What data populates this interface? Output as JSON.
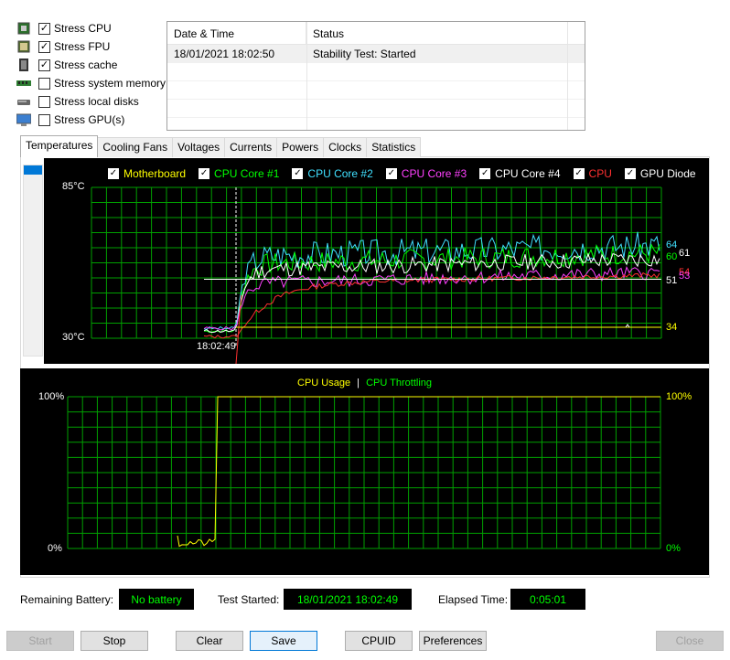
{
  "stress_options": [
    {
      "label": "Stress CPU",
      "checked": true,
      "icon": "cpu-icon"
    },
    {
      "label": "Stress FPU",
      "checked": true,
      "icon": "fpu-icon"
    },
    {
      "label": "Stress cache",
      "checked": true,
      "icon": "cache-icon"
    },
    {
      "label": "Stress system memory",
      "checked": false,
      "icon": "memory-icon"
    },
    {
      "label": "Stress local disks",
      "checked": false,
      "icon": "disk-icon"
    },
    {
      "label": "Stress GPU(s)",
      "checked": false,
      "icon": "gpu-icon"
    }
  ],
  "log": {
    "col_datetime": "Date & Time",
    "col_status": "Status",
    "rows": [
      {
        "datetime": "18/01/2021 18:02:50",
        "status": "Stability Test: Started"
      }
    ]
  },
  "tabs": [
    "Temperatures",
    "Cooling Fans",
    "Voltages",
    "Currents",
    "Powers",
    "Clocks",
    "Statistics"
  ],
  "active_tab": "Temperatures",
  "temp_graph": {
    "y_max_label": "85°C",
    "y_min_label": "30°C",
    "time_label": "18:02:49",
    "legend": [
      {
        "name": "Motherboard",
        "color": "#ffff00"
      },
      {
        "name": "CPU Core #1",
        "color": "#00ff00"
      },
      {
        "name": "CPU Core #2",
        "color": "#40e0ff"
      },
      {
        "name": "CPU Core #3",
        "color": "#ff40ff"
      },
      {
        "name": "CPU Core #4",
        "color": "#ffffff"
      },
      {
        "name": "CPU",
        "color": "#ff3030"
      },
      {
        "name": "GPU Diode",
        "color": "#ffffff"
      }
    ],
    "end_values": [
      {
        "value": "64",
        "color": "#40e0ff"
      },
      {
        "value": "61",
        "color": "#ffffff"
      },
      {
        "value": "60",
        "color": "#00ff00"
      },
      {
        "value": "54",
        "color": "#ff3030"
      },
      {
        "value": "53",
        "color": "#ff40ff"
      },
      {
        "value": "51",
        "color": "#ffffff"
      },
      {
        "value": "34",
        "color": "#ffff00"
      }
    ]
  },
  "usage_graph": {
    "title_cpu_usage": "CPU Usage",
    "separator": "|",
    "title_throttling": "CPU Throttling",
    "left_top": "100%",
    "left_bottom": "0%",
    "right_top": "100%",
    "right_bottom": "0%"
  },
  "info": {
    "battery_label": "Remaining Battery:",
    "battery_value": "No battery",
    "started_label": "Test Started:",
    "started_value": "18/01/2021 18:02:49",
    "elapsed_label": "Elapsed Time:",
    "elapsed_value": "0:05:01"
  },
  "buttons": {
    "start": "Start",
    "stop": "Stop",
    "clear": "Clear",
    "save": "Save",
    "cpuid": "CPUID",
    "preferences": "Preferences",
    "close": "Close"
  },
  "colors": {
    "graph_bg": "#000000",
    "grid": "#00a000",
    "info_text": "#00ff00"
  }
}
